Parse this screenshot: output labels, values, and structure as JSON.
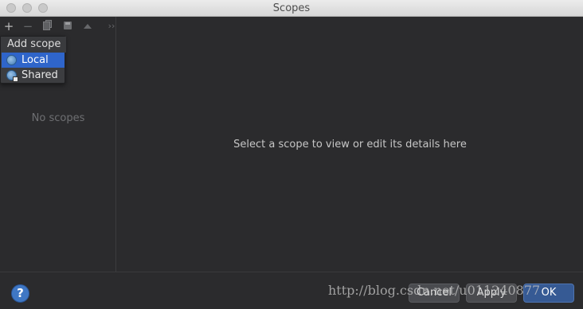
{
  "window": {
    "title": "Scopes"
  },
  "toolbar": {
    "add_icon": "plus-icon",
    "remove_icon": "minus-icon",
    "copy_icon": "copy-icon",
    "save_icon": "save-icon",
    "up_icon": "arrow-up-icon",
    "more_icon": "chevron-double-right-icon",
    "add": "+",
    "remove": "−",
    "more": "››"
  },
  "popup": {
    "title": "Add scope",
    "items": [
      {
        "label": "Local",
        "selected": true,
        "icon": "local-scope-icon"
      },
      {
        "label": "Shared",
        "selected": false,
        "icon": "shared-scope-icon"
      }
    ]
  },
  "left_panel": {
    "empty_text": "No scopes"
  },
  "right_panel": {
    "hint": "Select a scope to view or edit its details here"
  },
  "footer": {
    "help": "?",
    "cancel": "Cancel",
    "apply": "Apply",
    "ok": "OK"
  },
  "watermark": "http://blog.csdn.net/u011240877",
  "colors": {
    "background": "#2b2b2d",
    "selection": "#2f65ca",
    "help": "#3f77c4"
  }
}
